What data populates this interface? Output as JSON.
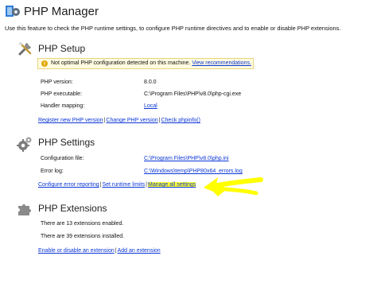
{
  "header": {
    "title": "PHP Manager",
    "description": "Use this feature to check the PHP runtime settings, to configure PHP runtime directives and to enable or disable PHP extensions."
  },
  "setup": {
    "title": "PHP Setup",
    "warning_text": "Not optimal PHP configuration detected on this machine.",
    "warning_link": "View recommendations.",
    "rows": [
      {
        "label": "PHP version:",
        "value": "8.0.0"
      },
      {
        "label": "PHP executable:",
        "value": "C:\\Program Files\\PHP\\v8.0\\php-cgi.exe"
      },
      {
        "label": "Handler mapping:",
        "value": "Local"
      }
    ],
    "links": [
      "Register new PHP version",
      "Change PHP version",
      "Check phpinfo()"
    ]
  },
  "settings": {
    "title": "PHP Settings",
    "rows": [
      {
        "label": "Configuration file:",
        "value": "C:\\Program Files\\PHP\\v8.0\\php.ini"
      },
      {
        "label": "Error log:",
        "value": "C:\\Windows\\temp\\PHP80x64_errors.log"
      }
    ],
    "links": [
      "Configure error reporting",
      "Set runtime limits",
      "Manage all settings"
    ]
  },
  "extensions": {
    "title": "PHP Extensions",
    "enabled_text": "There are 13 extensions enabled.",
    "installed_text": "There are 39 extensions installed.",
    "links": [
      "Enable or disable an extension",
      "Add an extension"
    ]
  },
  "colors": {
    "link": "#0b36d6",
    "highlight": "#ffff33",
    "arrow": "#ffff00",
    "warning_bg": "#fffbe1"
  },
  "icons": [
    "php-manager-icon",
    "setup-tools-icon",
    "warning-icon",
    "settings-gear-icon",
    "extensions-puzzle-icon"
  ]
}
